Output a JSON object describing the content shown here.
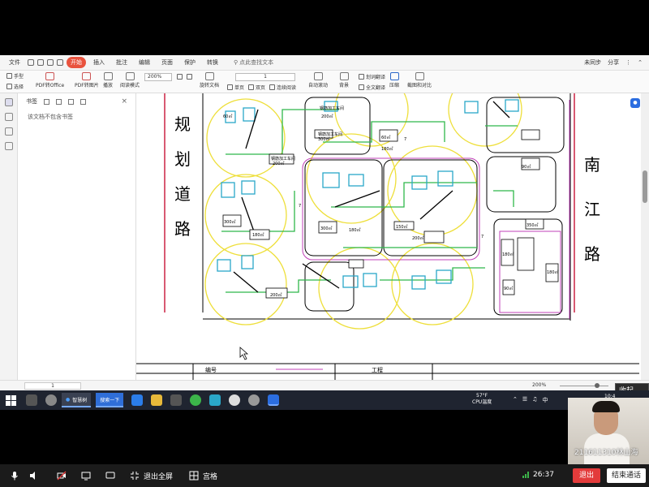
{
  "menu": {
    "tabs": [
      "文件",
      "开始",
      "插入",
      "批注",
      "编辑",
      "页面",
      "保护",
      "转换"
    ],
    "active_tab": "开始",
    "search_label": "点此查找文本",
    "right_items": [
      "未同步",
      "分享"
    ]
  },
  "ribbon": {
    "hand_label": "手型",
    "select_label": "选择",
    "pdf_to_office": "PDF转Office",
    "pdf_to_image": "PDF转图片",
    "play_label": "播放",
    "read_mode": "阅读模式",
    "zoom_value": "200%",
    "page_value": "1",
    "rotate_label": "旋转文档",
    "single_page": "单页",
    "double_page": "双页",
    "continuous": "连续阅读",
    "auto_scroll": "自动滚动",
    "background": "背景",
    "translate": "划词翻译",
    "full_translate": "全文翻译",
    "compress": "压缩",
    "screenshot_compare": "截图和对比"
  },
  "bookmark_panel": {
    "title": "书签",
    "empty_text": "该文档不包含书签"
  },
  "drawing": {
    "road_left": [
      "规",
      "划",
      "道",
      "路"
    ],
    "road_right": [
      "南",
      "江",
      "路"
    ],
    "labels": [
      "钢筋加工车间",
      "200㎡",
      "60㎡",
      "钢筋加工车间",
      "200㎡",
      "300㎡",
      "180㎡",
      "200㎡",
      "钢筋加工车间",
      "300㎡",
      "60㎡",
      "180㎡",
      "200㎡",
      "150㎡",
      "300㎡",
      "180㎡",
      "350㎡",
      "180㎡",
      "90㎡",
      "180㎡",
      "90㎡",
      "7",
      "7",
      "7"
    ],
    "table_labels": [
      "编号",
      "工程"
    ]
  },
  "statusbar": {
    "page_value": "1",
    "zoom_label": "200%"
  },
  "taskbar": {
    "items": [
      "智慧树",
      "搜索一下"
    ],
    "weather_temp": "57°F",
    "weather_label": "CPU温度",
    "lang": "中",
    "time": "10:4"
  },
  "video": {
    "name": "211611310林山海",
    "collapse_label": "收起"
  },
  "meeting": {
    "exit_fullscreen": "退出全屏",
    "grid_label": "宫格",
    "timer": "26:37",
    "leave_label": "退出",
    "end_label": "结束通话"
  },
  "colors": {
    "accent": "#e9533e",
    "drawing_green": "#2fb84a",
    "drawing_yellow": "#eedf3a",
    "drawing_cyan": "#2aa7c8",
    "drawing_magenta": "#c140b8",
    "leave_red": "#e33b3b"
  }
}
